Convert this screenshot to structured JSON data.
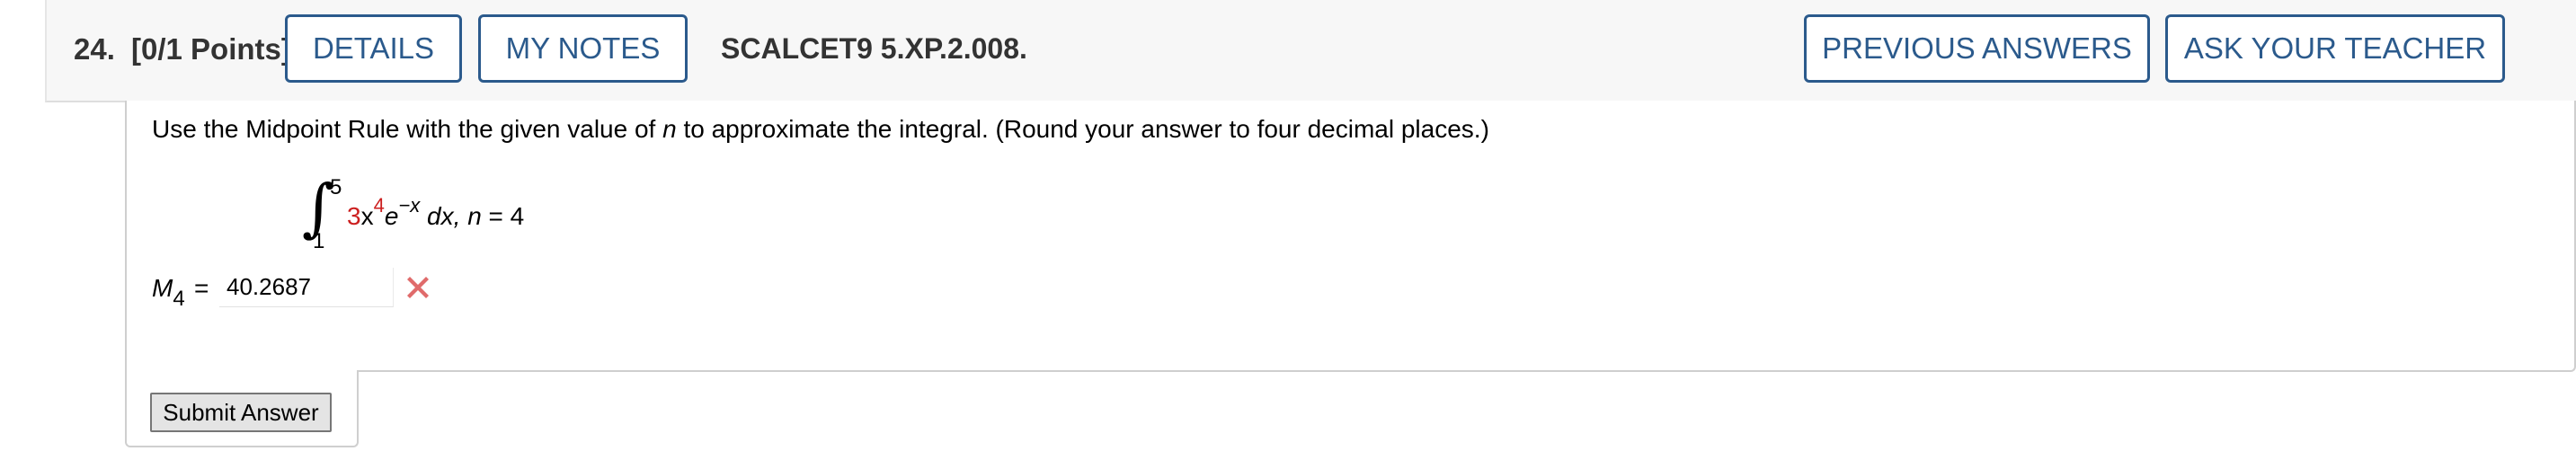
{
  "header": {
    "question_number": "24.",
    "points": "[0/1 Points]",
    "details_label": "DETAILS",
    "my_notes_label": "MY NOTES",
    "question_id": "SCALCET9 5.XP.2.008.",
    "previous_answers_label": "PREVIOUS ANSWERS",
    "ask_teacher_label": "ASK YOUR TEACHER"
  },
  "question": {
    "instructions_prefix": "Use the Midpoint Rule with the given value of ",
    "instructions_var": "n",
    "instructions_suffix": " to approximate the integral. (Round your answer to four decimal places.)",
    "integral": {
      "upper_limit": "5",
      "lower_limit": "1",
      "coefficient": "3",
      "var_x": "x",
      "exponent": "4",
      "exp_base": "e",
      "exp_power": "−x",
      "differential": " dx, ",
      "n_var": "n",
      "n_eq": " = 4"
    },
    "answer_label": "M",
    "answer_subscript": "4",
    "equals": "=",
    "answer_value": "40.2687",
    "answer_status": "incorrect"
  },
  "submit_label": "Submit Answer",
  "colors": {
    "accent": "#2b5a8c",
    "error": "#e06b6b",
    "highlight_red": "#cc1f1f"
  }
}
